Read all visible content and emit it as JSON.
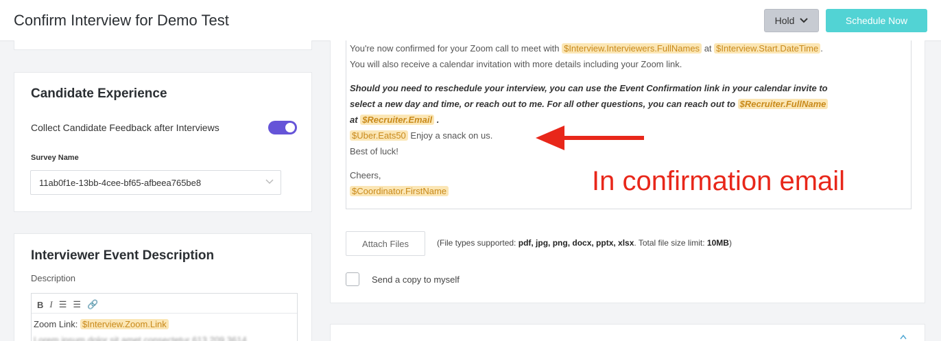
{
  "header": {
    "title": "Confirm Interview for Demo Test",
    "hold_label": "Hold",
    "schedule_label": "Schedule Now"
  },
  "candidate_experience": {
    "title": "Candidate Experience",
    "toggle_label": "Collect Candidate Feedback after Interviews",
    "toggle_on": true,
    "survey_label": "Survey Name",
    "survey_value": "11ab0f1e-13bb-4cee-bf65-afbeea765be8"
  },
  "interviewer_event": {
    "title": "Interviewer Event Description",
    "description_label": "Description",
    "toolbar": [
      "B",
      "I",
      "☰",
      "☰",
      "🔗"
    ],
    "zoom_prefix": "Zoom Link:",
    "zoom_token": "$Interview.Zoom.Link",
    "blurred_text": "Lorem ipsum dolor sit amet consectetur 613 209 3614"
  },
  "email": {
    "line1_prefix": "You're now confirmed for your Zoom call to meet with",
    "line1_token1": "$Interview.Interviewers.FullNames",
    "line1_mid": "at",
    "line1_token2": "$Interview.Start.DateTime",
    "line1_suffix": ".",
    "line2": "You will also receive a calendar invitation with more details including your Zoom link.",
    "bold_line1": "Should you need to reschedule your interview, you can use the Event Confirmation link in your calendar invite to",
    "bold_line2_prefix": "select a new day and time, or reach out to me. For all other questions, you can reach out to",
    "bold_token1": "$Recruiter.FullName",
    "bold_line3_prefix": "at",
    "bold_token2": "$Recruiter.Email",
    "bold_line3_suffix": ".",
    "uber_token": "$Uber.Eats50",
    "uber_text": "Enjoy a snack on us.",
    "best": "Best of luck!",
    "cheers": "Cheers,",
    "coordinator_token": "$Coordinator.FirstName"
  },
  "annotation": {
    "text": "In confirmation email",
    "color": "#e8271a"
  },
  "attachments": {
    "button_label": "Attach Files",
    "info_prefix": "(File types supported:",
    "info_types": "pdf, jpg, png, docx, pptx, xlsx",
    "info_mid": ". Total file size limit:",
    "info_limit": "10MB",
    "info_suffix": ")"
  },
  "copy_to_self": {
    "label": "Send a copy to myself",
    "checked": false
  },
  "colors": {
    "accent": "#52d3d4",
    "toggle": "#6554d8",
    "token_bg": "#fbe6b5"
  }
}
